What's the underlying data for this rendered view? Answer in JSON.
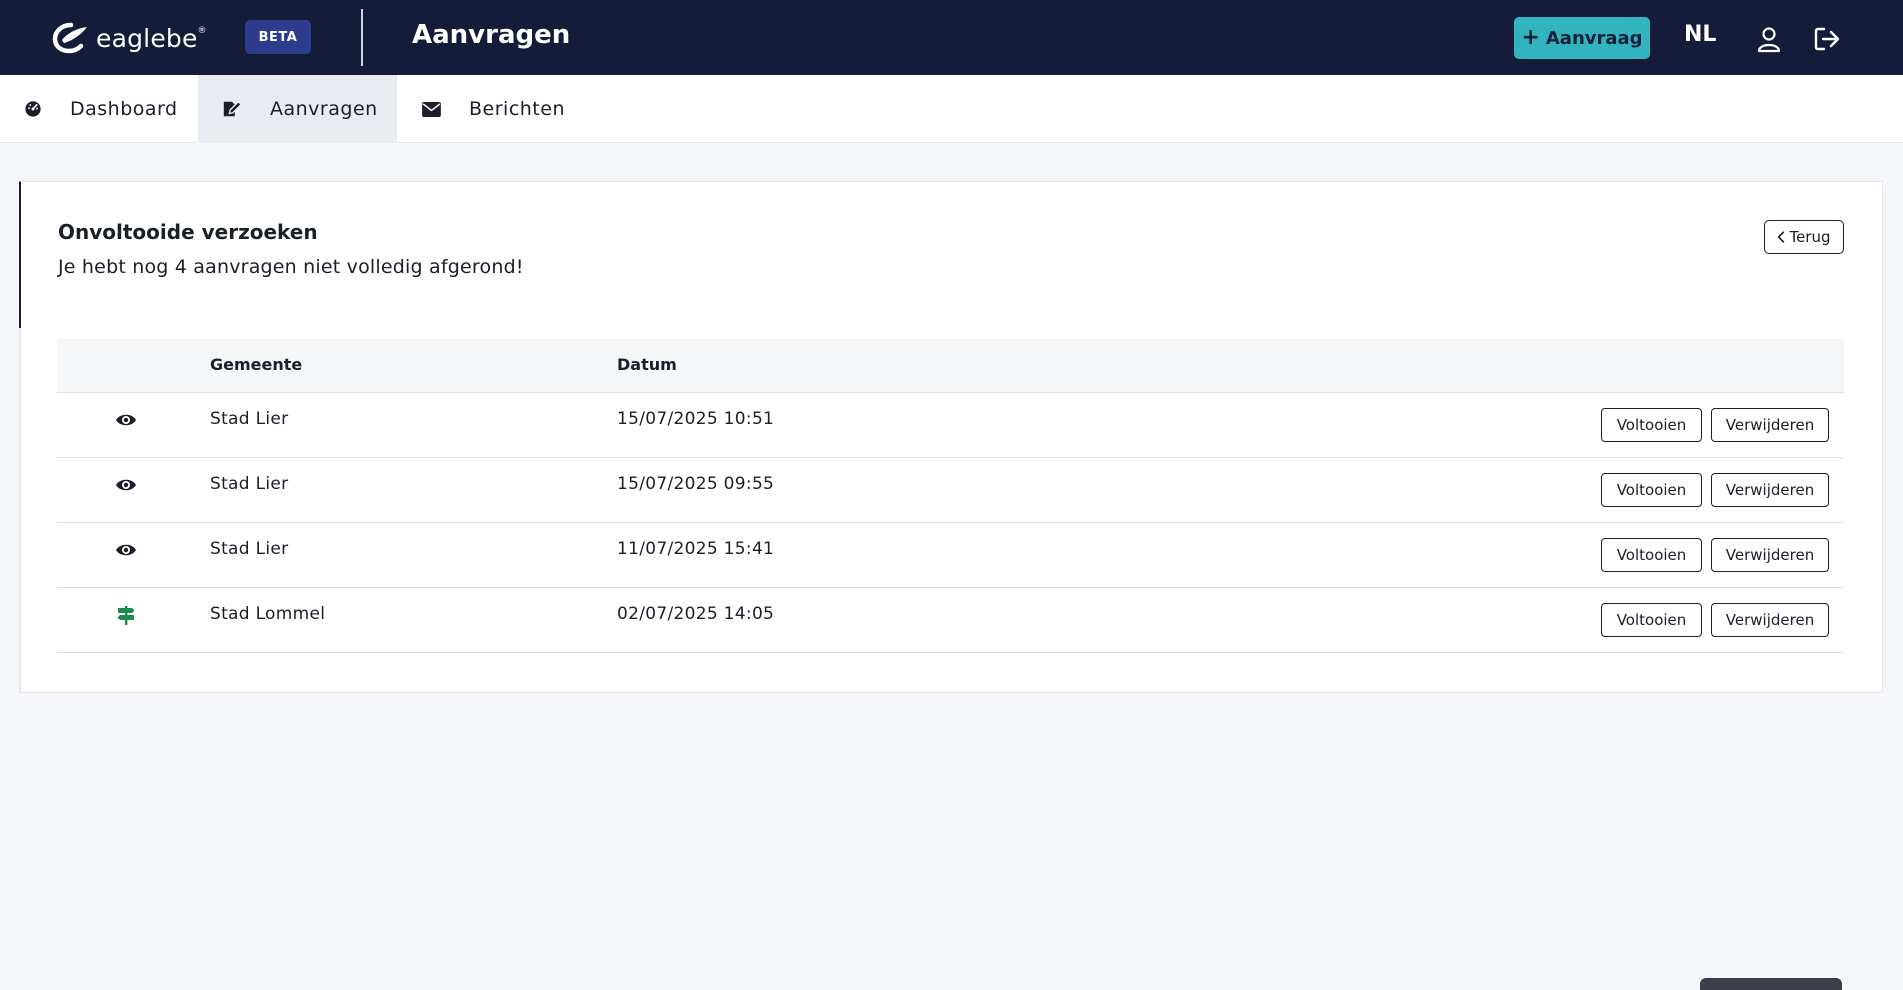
{
  "header": {
    "logo_text": "eaglebe",
    "logo_reg": "®",
    "beta_label": "BETA",
    "page_title": "Aanvragen",
    "new_request_label": "Aanvraag",
    "language": "NL"
  },
  "tabs": [
    {
      "label": "Dashboard",
      "icon": "dashboard-icon",
      "active": false
    },
    {
      "label": "Aanvragen",
      "icon": "edit-document-icon",
      "active": true
    },
    {
      "label": "Berichten",
      "icon": "envelope-icon",
      "active": false
    }
  ],
  "card": {
    "title": "Onvoltooide verzoeken",
    "subtitle": "Je hebt nog 4 aanvragen niet volledig afgerond!",
    "back_label": "Terug"
  },
  "table": {
    "headers": {
      "municipality": "Gemeente",
      "date": "Datum"
    },
    "rows": [
      {
        "icon": "eye-icon",
        "municipality": "Stad Lier",
        "date": "15/07/2025 10:51",
        "complete_label": "Voltooien",
        "delete_label": "Verwijderen"
      },
      {
        "icon": "eye-icon",
        "municipality": "Stad Lier",
        "date": "15/07/2025 09:55",
        "complete_label": "Voltooien",
        "delete_label": "Verwijderen"
      },
      {
        "icon": "eye-icon",
        "municipality": "Stad Lier",
        "date": "11/07/2025 15:41",
        "complete_label": "Voltooien",
        "delete_label": "Verwijderen"
      },
      {
        "icon": "signpost-icon",
        "municipality": "Stad Lommel",
        "date": "02/07/2025 14:05",
        "complete_label": "Voltooien",
        "delete_label": "Verwijderen"
      }
    ]
  },
  "colors": {
    "topbar": "#141c3a",
    "accent": "#32b4bf",
    "beta_badge": "#2e3c8e",
    "signpost_icon": "#1e8a4c"
  }
}
